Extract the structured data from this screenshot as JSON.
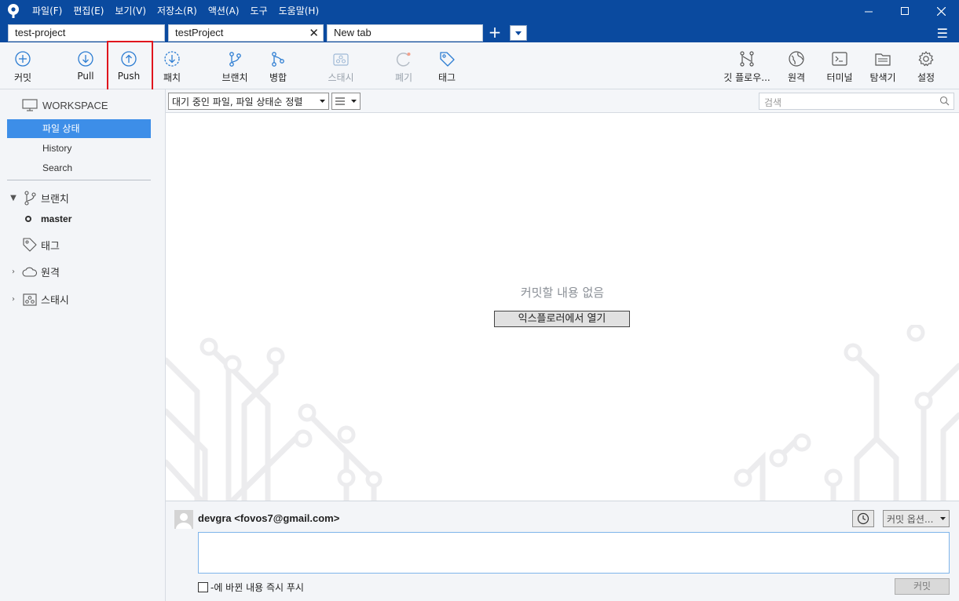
{
  "titlebar": {
    "menus": [
      "파일(F)",
      "편집(E)",
      "보기(V)",
      "저장소(R)",
      "액션(A)",
      "도구",
      "도움말(H)"
    ]
  },
  "tabs": [
    {
      "label": "test-project"
    },
    {
      "label": "testProject",
      "active": true
    },
    {
      "label": "New tab"
    }
  ],
  "toolbar": {
    "commit": "커밋",
    "pull": "Pull",
    "push": "Push",
    "patch": "패치",
    "branch": "브랜치",
    "merge": "병합",
    "stash": "스태시",
    "discard": "폐기",
    "tag": "태그",
    "gitflow": "깃 플로우...",
    "remote": "원격",
    "terminal": "터미널",
    "explorer": "탐색기",
    "settings": "설정"
  },
  "sidebar": {
    "workspace": "WORKSPACE",
    "items": [
      {
        "label": "파일 상태",
        "active": true
      },
      {
        "label": "History"
      },
      {
        "label": "Search"
      }
    ],
    "branches_label": "브랜치",
    "current_branch": "master",
    "tags_label": "태그",
    "remotes_label": "원격",
    "stashes_label": "스태시"
  },
  "main": {
    "sort_select": "대기 중인 파일, 파일 상태순 정렬",
    "search_placeholder": "검색",
    "empty_message": "커밋할 내용 없음",
    "open_explorer": "익스플로러에서 열기"
  },
  "commit": {
    "author": "devgra <fovos7@gmail.com>",
    "options": "커밋 옵션...",
    "push_immediately": "-에 바뀐 내용 즉시 푸시",
    "commit_button": "커밋"
  },
  "colors": {
    "titlebar": "#0a4a9f",
    "accent": "#3d8ee8",
    "icon": "#2d7dd2",
    "highlight": "#e0161e"
  }
}
